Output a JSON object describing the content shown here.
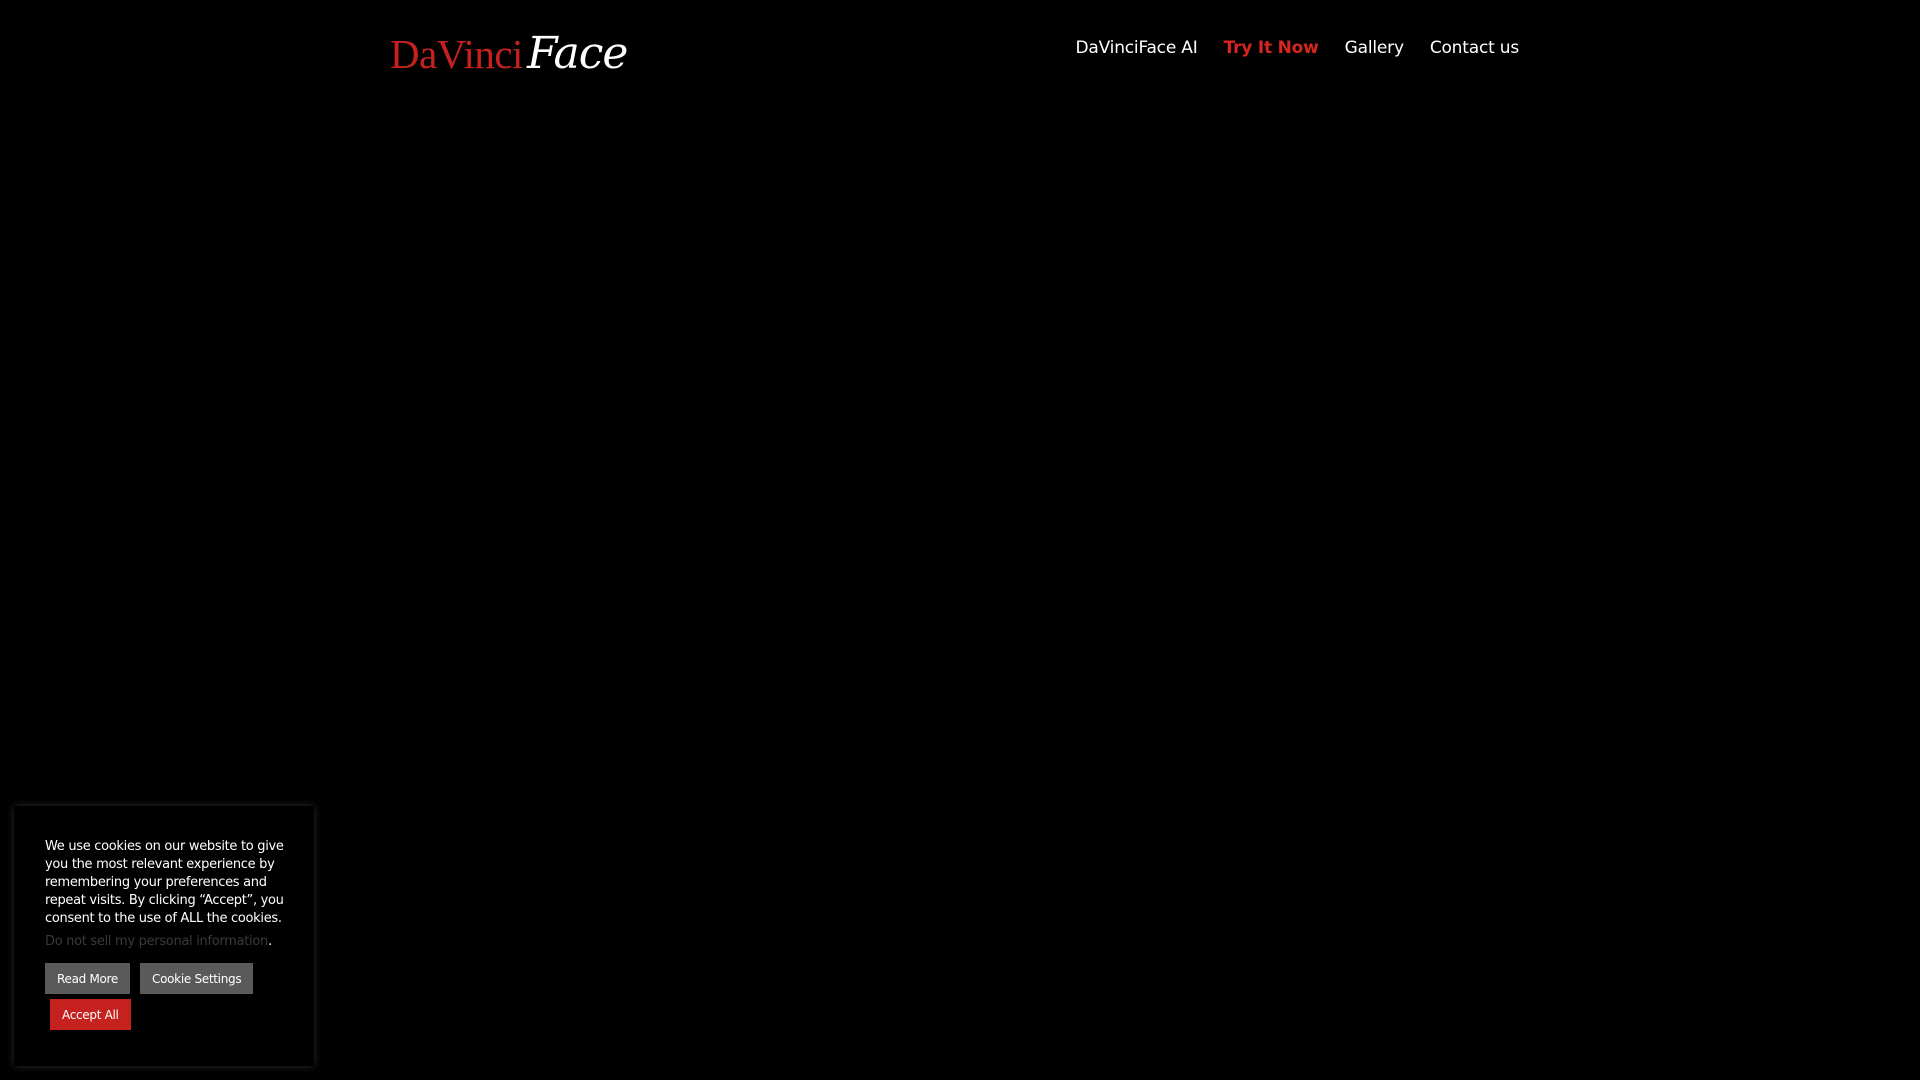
{
  "brand": {
    "logo_part1": "DaVinci",
    "logo_part2": "Face",
    "accent_color": "#c5221f"
  },
  "nav": {
    "items": [
      {
        "label": "DaVinciFace AI",
        "active": false
      },
      {
        "label": "Try It Now",
        "active": true
      },
      {
        "label": "Gallery",
        "active": false
      },
      {
        "label": "Contact us",
        "active": false
      }
    ]
  },
  "cookie_banner": {
    "message": "We use cookies on our website to give you the most relevant experience by remembering your preferences and repeat visits. By clicking “Accept”, you consent to the use of ALL the cookies.",
    "optout_link": "Do not sell my personal information",
    "optout_suffix": ".",
    "read_more_label": "Read More",
    "settings_label": "Cookie Settings",
    "accept_label": "Accept All"
  }
}
